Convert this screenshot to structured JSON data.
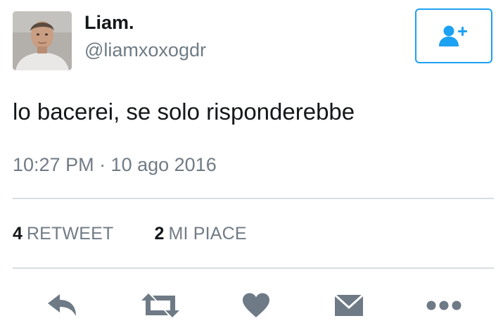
{
  "tweet": {
    "display_name": "Liam.",
    "handle": "@liamxoxogdr",
    "text": "lo bacerei, se solo risponderebbe",
    "timestamp": "10:27 PM · 10 ago 2016"
  },
  "stats": {
    "retweets": {
      "count": "4",
      "label": "RETWEET"
    },
    "likes": {
      "count": "2",
      "label": "MI PIACE"
    }
  },
  "icons": {
    "follow": "add-user-icon",
    "reply": "reply-icon",
    "retweet": "retweet-icon",
    "like": "heart-icon",
    "dm": "envelope-icon",
    "more": "more-dots-icon"
  },
  "colors": {
    "accent": "#1da1f2",
    "text": "#14171a",
    "muted": "#707b85",
    "icon": "#6e7a86",
    "divider": "#d8dde1"
  }
}
